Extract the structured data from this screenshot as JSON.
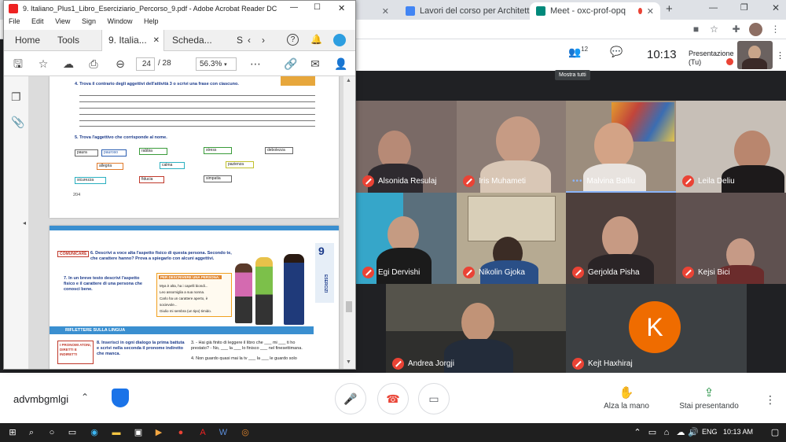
{
  "chrome": {
    "tabs": [
      {
        "label": "",
        "color": "#e0e0e0"
      },
      {
        "label": "Lavori del corso per Architettu",
        "color": "#4285f4"
      },
      {
        "label": "Meet - oxc-prof-opq",
        "color": "#00897b"
      }
    ],
    "new_tab": "+"
  },
  "meet": {
    "people_count": "12",
    "clock": "10:13",
    "presentation_label": "Presentazione (Tu)",
    "self_label": "Tu",
    "tooltip": "Mostra tutti",
    "participants": [
      {
        "name": "Alsonida Resulaj"
      },
      {
        "name": "Iris Muhameti"
      },
      {
        "name": "Malvina Balliu"
      },
      {
        "name": "Leila Deliu"
      },
      {
        "name": "Egi Dervishi"
      },
      {
        "name": "Nikolin Gjoka"
      },
      {
        "name": "Gerjolda Pisha"
      },
      {
        "name": "Kejsi Bici"
      },
      {
        "name": "Andrea Jorgji"
      },
      {
        "name": "Kejt Haxhiraj",
        "initial": "K"
      }
    ],
    "meeting_code": "advmbgmlgi",
    "raise_hand": "Alza la mano",
    "presenting": "Stai presentando"
  },
  "acrobat": {
    "title": "9. Italiano_Plus1_Libro_Eserciziario_Percorso_9.pdf - Adobe Acrobat Reader DC",
    "menu": [
      "File",
      "Edit",
      "View",
      "Sign",
      "Window",
      "Help"
    ],
    "tabs": [
      "Home",
      "Tools",
      "9. Italia...",
      "Scheda...",
      "S"
    ],
    "current_page": "24",
    "total_pages": "/ 28",
    "zoom": "56.3%",
    "page1": {
      "ex4": "4.  Trova il contrario degli aggettivi dell'attività 3 o scrivi una frase con ciascuno.",
      "ex5": "5.  Trova l'aggettivo che corrisponde al nome.",
      "words": [
        "paura",
        "pauroso",
        "rabbia",
        "stress",
        "debolezza",
        "allegria",
        "calma",
        "pazienza",
        "sicurezza",
        "fiducia",
        "simpatia"
      ],
      "page_number": "204"
    },
    "page2": {
      "chip": "COMUNICARE",
      "ex6": "6.  Descrivi a voce alta l'aspetto fisico di questa persona. Secondo te, che carattere hanno? Prova a spiegarlo con alcuni aggettivi.",
      "ex7": "7.  In un breve testo descrivi l'aspetto fisico e il carattere di una persona che conosci bene.",
      "box_title": "PER DESCRIVERE UNA PERSONA:",
      "box_lines": [
        "Mya è alta, ha i capelli biondi...",
        "Leo assomiglia a sua nonna.",
        "Carlo ha un carattere aperto, è",
        "socievole...",
        "Giulio mi sembra (un tipo) timido."
      ],
      "section": "RIFLETTERE SULLA LINGUA",
      "sidebar_label": "I PRONOMI ATONI, DIRETTI E INDIRETTI",
      "ex8": "8.  Inserisci in ogni dialogo la prima battuta e scrivi nella seconda il pronome indiretto che manca.",
      "dialog": [
        "3.  - Hai già finito di leggere il libro che ___ mi ___ ti ho prestato? - No, ___ la ___ lo finisco ___ nel finesettimana.",
        "4.  Non guardo quasi mai la tv ___ la ___ le guardo solo"
      ],
      "chapter": "9",
      "side_word": "ESERCIZI"
    }
  },
  "taskbar": {
    "lang": "ENG",
    "time": "10:13 AM"
  }
}
